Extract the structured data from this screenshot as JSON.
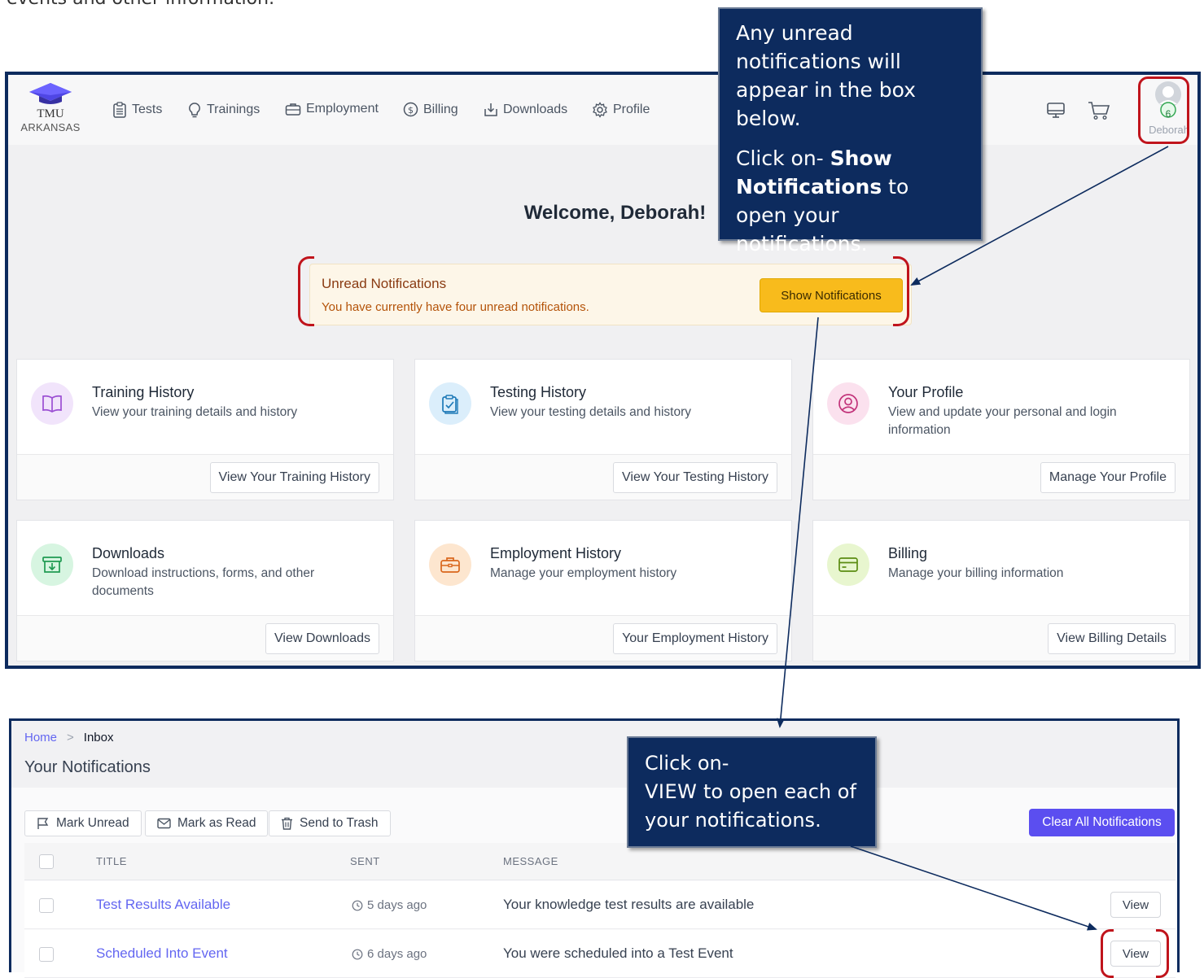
{
  "intro_text": "events and other information.",
  "brand": {
    "line1": "TMU",
    "line2": "ARKANSAS"
  },
  "nav": {
    "items": [
      {
        "label": "Tests",
        "icon": "clipboard-icon"
      },
      {
        "label": "Trainings",
        "icon": "lightbulb-icon"
      },
      {
        "label": "Employment",
        "icon": "briefcase-icon"
      },
      {
        "label": "Billing",
        "icon": "dollar-icon"
      },
      {
        "label": "Downloads",
        "icon": "download-icon"
      },
      {
        "label": "Profile",
        "icon": "gear-icon"
      }
    ],
    "notification_count": "6",
    "user_name": "Deborah"
  },
  "welcome": "Welcome, Deborah!",
  "unread_box": {
    "title": "Unread Notifications",
    "subtitle": "You have currently have four unread notifications.",
    "button": "Show Notifications"
  },
  "cards": [
    {
      "title": "Training History",
      "desc": "View your training details and history",
      "button": "View Your Training History",
      "icon": "book-icon",
      "bg": "#f1e4fb",
      "fg": "#9b4fd3"
    },
    {
      "title": "Testing History",
      "desc": "View your testing details and history",
      "button": "View Your Testing History",
      "icon": "clipboard-check-icon",
      "bg": "#dbeefb",
      "fg": "#1f7ab8"
    },
    {
      "title": "Your Profile",
      "desc": "View and update your personal and login information",
      "button": "Manage Your Profile",
      "icon": "user-circle-icon",
      "bg": "#fbe1ee",
      "fg": "#c2337a"
    },
    {
      "title": "Downloads",
      "desc": "Download instructions, forms, and other documents",
      "button": "View Downloads",
      "icon": "archive-download-icon",
      "bg": "#d7f5e1",
      "fg": "#1f9a52"
    },
    {
      "title": "Employment History",
      "desc": "Manage your employment history",
      "button": "Your Employment History",
      "icon": "briefcase-icon",
      "bg": "#fde6cf",
      "fg": "#d9661c"
    },
    {
      "title": "Billing",
      "desc": "Manage your billing information",
      "button": "View Billing Details",
      "icon": "credit-card-icon",
      "bg": "#e8f6cf",
      "fg": "#5b8c12"
    }
  ],
  "callout_top": {
    "line1": "Any unread notifications will appear in the box below.",
    "line2_pre": "Click on- ",
    "line2_bold": "Show Notifications",
    "line2_post": " to open your notifications."
  },
  "callout_bottom": {
    "pre": "Click on-",
    "bold": "VIEW",
    "post": " to open each of your notifications."
  },
  "inbox": {
    "breadcrumb_home": "Home",
    "breadcrumb_current": "Inbox",
    "title": "Your Notifications",
    "toolbar": {
      "mark_unread": "Mark Unread",
      "mark_read": "Mark as Read",
      "trash": "Send to Trash",
      "clear_all": "Clear All Notifications"
    },
    "columns": {
      "title": "TITLE",
      "sent": "SENT",
      "message": "MESSAGE"
    },
    "rows": [
      {
        "title": "Test Results Available",
        "sent": "5 days ago",
        "message": "Your knowledge test results are available",
        "action": "View"
      },
      {
        "title": "Scheduled Into Event",
        "sent": "6 days ago",
        "message": "You were scheduled into a Test Event",
        "action": "View"
      }
    ]
  }
}
